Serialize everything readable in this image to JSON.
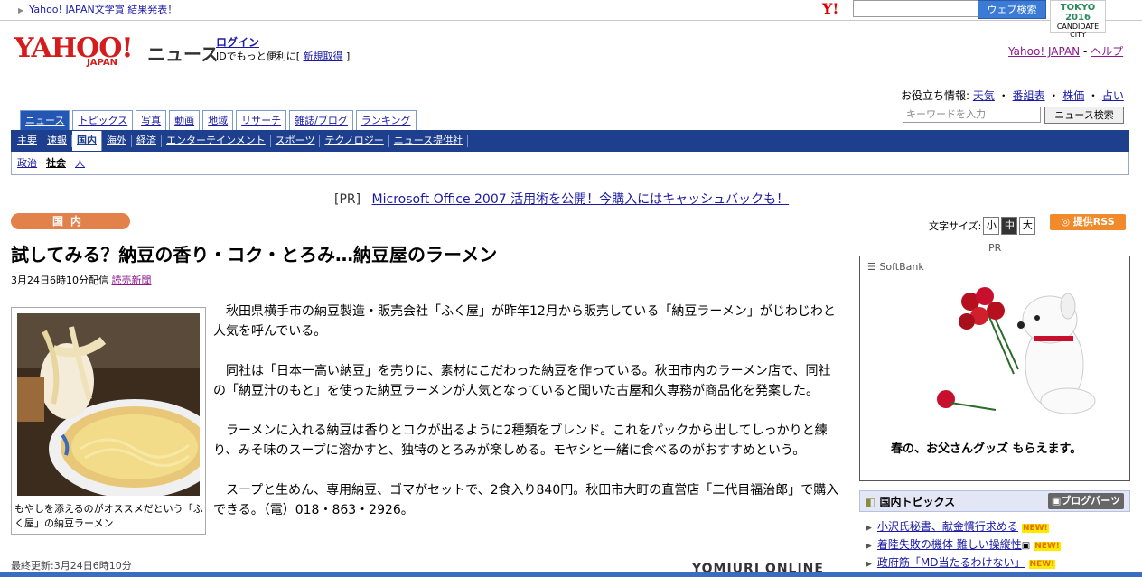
{
  "top": {
    "news_link": "Yahoo! JAPAN文学賞 結果発表！",
    "y_mark": "Y!",
    "web_search_button": "ウェブ検索",
    "tokyo_logo": "TOKYO 2016",
    "tokyo_sub": "CANDIDATE CITY"
  },
  "header": {
    "logo": "YAHOO!",
    "logo_sub": "JAPAN",
    "service": "ニュース",
    "login": "ログイン",
    "id_prompt": "IDでもっと便利に[",
    "register": "新規取得",
    "id_end": "]",
    "yahoo_japan_link": "Yahoo! JAPAN",
    "separator": "-",
    "help_link": "ヘルプ",
    "useful_label": "お役立ち情報:",
    "useful_links": [
      "天気",
      "番組表",
      "株価",
      "占い"
    ],
    "keyword_placeholder": "キーワードを入力",
    "news_search_button": "ニュース検索"
  },
  "tabs": [
    "ニュース",
    "トピックス",
    "写真",
    "動画",
    "地域",
    "リサーチ",
    "雑誌/ブログ",
    "ランキング"
  ],
  "categories": [
    "主要",
    "速報",
    "国内",
    "海外",
    "経済",
    "エンターテインメント",
    "スポーツ",
    "テクノロジー",
    "ニュース提供社"
  ],
  "subcategories": [
    "政治",
    "社会",
    "人"
  ],
  "pr": {
    "label": "[PR]",
    "text": "Microsoft Office 2007 活用術を公開！今購入にはキャッシュバックも！"
  },
  "article": {
    "category": "国内",
    "font_size_label": "文字サイズ:",
    "font_sizes": [
      "小",
      "中",
      "大"
    ],
    "rss": "提供RSS",
    "headline": "試してみる？納豆の香り・コク・とろみ…納豆屋のラーメン",
    "date": "3月24日6時10分配信",
    "source": "読売新聞",
    "caption": "もやしを添えるのがオススメだという「ふく屋」の納豆ラーメン",
    "paragraphs": [
      "　秋田県横手市の納豆製造・販売会社「ふく屋」が昨年12月から販売している「納豆ラーメン」がじわじわと人気を呼んでいる。",
      "　同社は「日本一高い納豆」を売りに、素材にこだわった納豆を作っている。秋田市内のラーメン店で、同社の「納豆汁のもと」を使った納豆ラーメンが人気となっていると聞いた古屋和久専務が商品化を発案した。",
      "　ラーメンに入れる納豆は香りとコクが出るように2種類をブレンド。これをパックから出してしっかりと練り、みそ味のスープに溶かすと、独特のとろみが楽しめる。モヤシと一緒に食べるのがおすすめという。",
      "　スープと生めん、専用納豆、ゴマがセットで、2食入り840円。秋田市大町の直営店「二代目福治郎」で購入できる。（電）018・863・2926。"
    ],
    "updated": "最終更新:3月24日6時10分",
    "footer_source": "YOMIURI ONLINE"
  },
  "ad": {
    "pr_label": "PR",
    "brand": "SoftBank",
    "copy": "春の、お父さんグッズ もらえます。"
  },
  "topics": {
    "title": "国内トピックス",
    "blog_parts": "ブログパーツ",
    "new_badge": "NEW!",
    "items": [
      "小沢氏秘書、献金慣行求める",
      "着陸失敗の機体 難しい操縦性",
      "政府筋「MD当たるわけない」"
    ]
  }
}
